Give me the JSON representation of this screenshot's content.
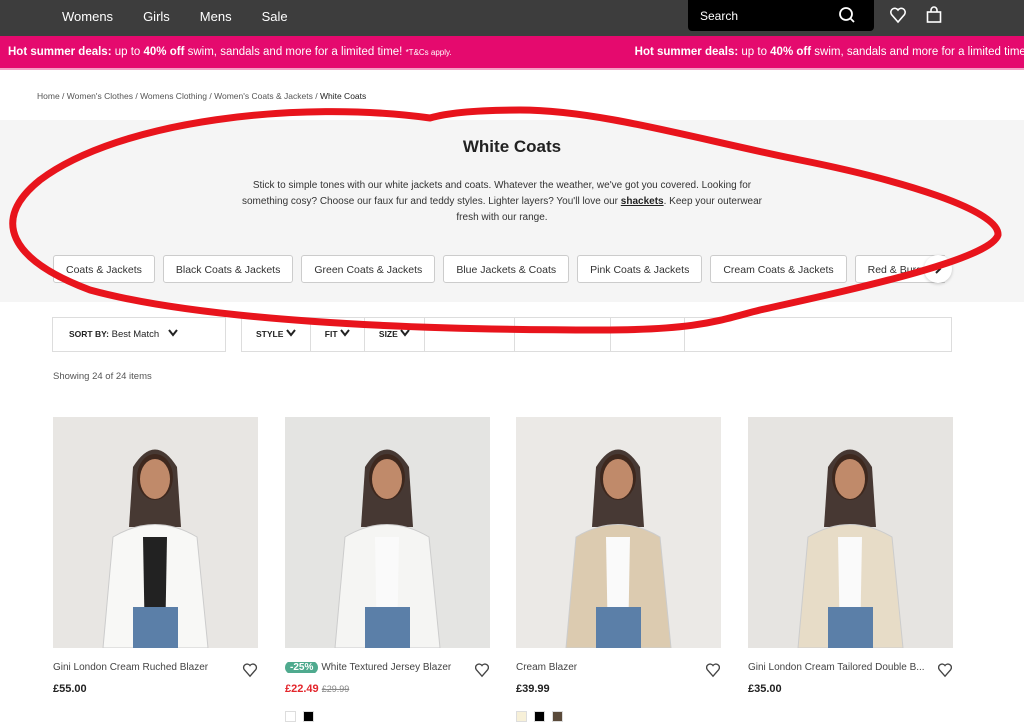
{
  "nav": {
    "items": [
      "Womens",
      "Girls",
      "Mens",
      "Sale"
    ],
    "search_placeholder": "Search"
  },
  "promo": {
    "bold": "Hot summer deals:",
    "text1": " up to ",
    "pct": "40%",
    "off": " off",
    "text2": " swim, sandals and more for a limited time! ",
    "tc": "*T&Cs apply."
  },
  "breadcrumb": [
    "Home",
    "Women's Clothes",
    "Womens Clothing",
    "Women's Coats & Jackets"
  ],
  "breadcrumb_current": "White Coats",
  "hero": {
    "title": "White Coats",
    "desc1": "Stick to simple tones with our white jackets and coats. Whatever the weather, we've got you covered. Looking for something cosy? Choose our faux fur and teddy styles. Lighter layers? You'll love our ",
    "link": "shackets",
    "desc2": ". Keep your outerwear fresh with our range."
  },
  "chips": [
    "Coats & Jackets",
    "Black Coats & Jackets",
    "Green Coats & Jackets",
    "Blue Jackets & Coats",
    "Pink Coats & Jackets",
    "Cream Coats & Jackets",
    "Red & Burgundy"
  ],
  "sort": {
    "label": "SORT BY:",
    "value": "Best Match"
  },
  "filters": [
    "STYLE",
    "FIT",
    "SIZE"
  ],
  "showing": "Showing 24 of 24 items",
  "products": [
    {
      "name": "Gini London Cream Ruched Blazer",
      "price": "£55.00",
      "swatches": []
    },
    {
      "name": "White Textured Jersey Blazer",
      "discount": "-25%",
      "price": "£22.49",
      "was": "£29.99",
      "swatches": [
        "#ffffff",
        "#000000"
      ]
    },
    {
      "name": "Cream Blazer",
      "price": "£39.99",
      "swatches": [
        "#f7f0d8",
        "#000000",
        "#5a4a3a"
      ]
    },
    {
      "name": "Gini London Cream Tailored Double B...",
      "price": "£35.00",
      "swatches": []
    }
  ],
  "colors": {
    "promo": "#e50a6e",
    "nav": "#3d3d3d",
    "sale": "#e3262c",
    "discount": "#4faa8e",
    "annotation": "#e8141c"
  }
}
